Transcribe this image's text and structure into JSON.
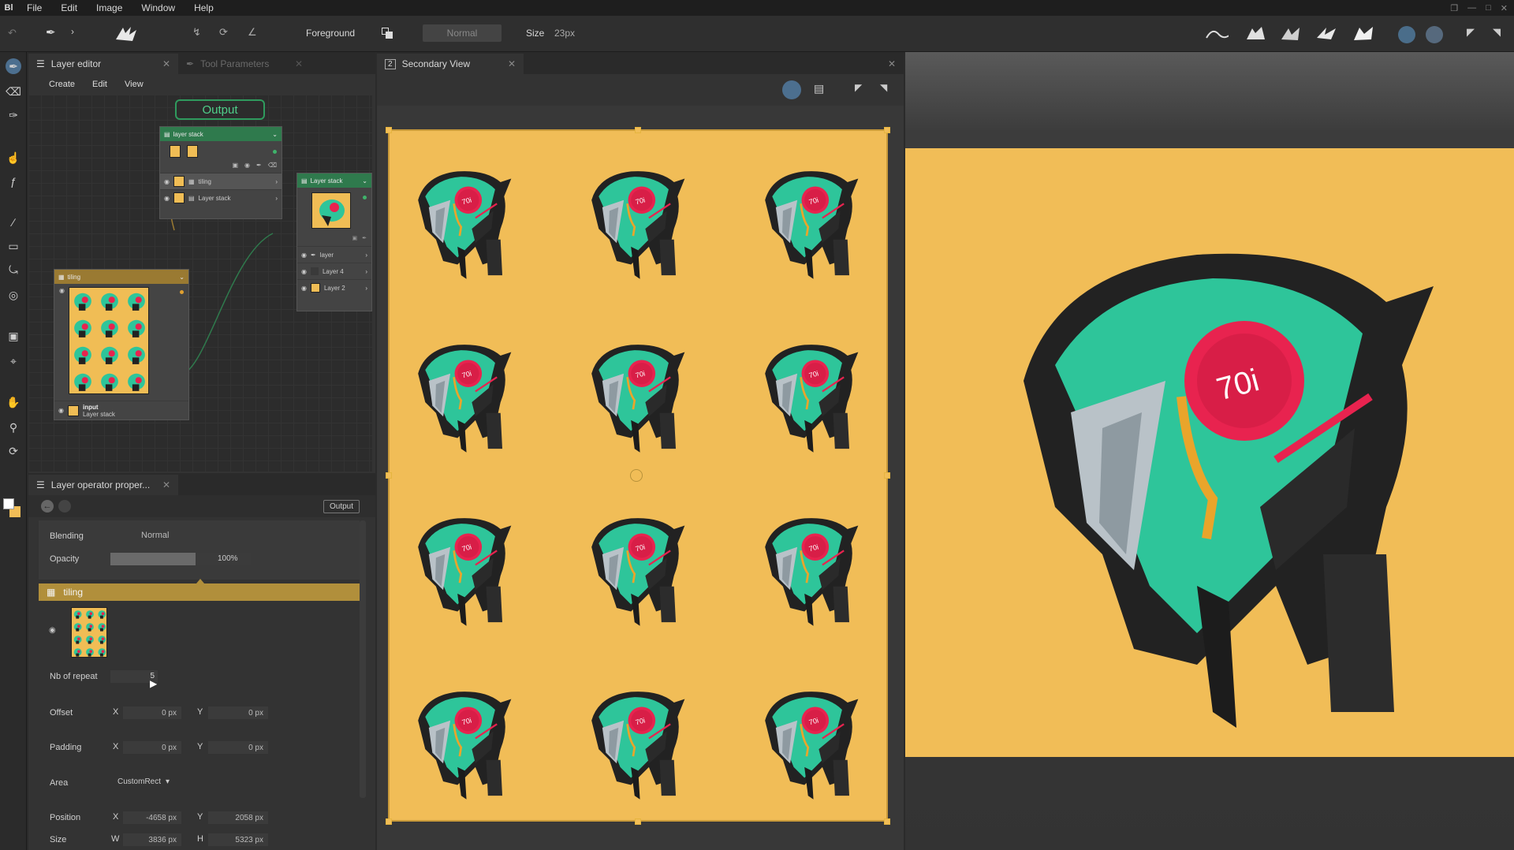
{
  "app": {
    "logo": "Bl"
  },
  "menu": [
    "File",
    "Edit",
    "Image",
    "Window",
    "Help"
  ],
  "toolbar": {
    "color_mode_label": "Foreground",
    "blend_mode": "Normal",
    "size_label": "Size",
    "size_value": "23px"
  },
  "layer_editor": {
    "tab_label": "Layer editor",
    "inactive_tab": "Tool Parameters",
    "menu": [
      "Create",
      "Edit",
      "View"
    ],
    "output_node": "Output",
    "stack_node": {
      "title": "layer stack",
      "rows": [
        "tiling",
        "Layer stack"
      ]
    },
    "right_stack": {
      "title": "Layer stack",
      "rows": [
        "layer",
        "Layer 4",
        "Layer 2"
      ]
    },
    "tiling_node": {
      "title": "tiling",
      "input_label": "input",
      "input_value": "Layer stack"
    }
  },
  "props": {
    "tab_label": "Layer operator proper...",
    "output_btn": "Output",
    "blending_label": "Blending",
    "blending_value": "Normal",
    "opacity_label": "Opacity",
    "opacity_value": "100%",
    "opacity_fraction": 1.0,
    "section_title": "tiling",
    "nb_repeat_label": "Nb of repeat",
    "nb_repeat_value": "5",
    "offset_label": "Offset",
    "offset_x": "0 px",
    "offset_y": "0 px",
    "padding_label": "Padding",
    "padding_x": "0 px",
    "padding_y": "0 px",
    "area_label": "Area",
    "area_value": "CustomRect",
    "position_label": "Position",
    "position_x": "-4658 px",
    "position_y": "2058 px",
    "size_label": "Size",
    "size_w": "3836 px",
    "size_h": "5323 px",
    "axis_x": "X",
    "axis_y": "Y",
    "axis_w": "W",
    "axis_h": "H"
  },
  "secondary_view": {
    "number": "2",
    "tab_label": "Secondary View"
  },
  "artwork": {
    "badge_text": "70i",
    "bg_color": "#f1bd57",
    "accent": "#2ec59a",
    "red": "#e8234f"
  }
}
